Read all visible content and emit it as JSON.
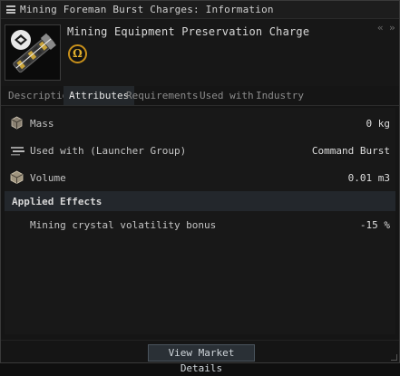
{
  "window": {
    "title": "Mining Foreman Burst Charges: Information"
  },
  "item": {
    "name": "Mining Equipment Preservation Charge",
    "badge_symbol": "Ω",
    "badge_color": "#c8901b",
    "icon": "mining-charge-icon"
  },
  "tabs": [
    {
      "label": "Description",
      "active": false
    },
    {
      "label": "Attributes",
      "active": true
    },
    {
      "label": "Requirements",
      "active": false
    },
    {
      "label": "Used with",
      "active": false
    },
    {
      "label": "Industry",
      "active": false
    }
  ],
  "attributes": [
    {
      "label": "Mass",
      "value": "0 kg",
      "icon": "mass-icon"
    },
    {
      "label": "Used with (Launcher Group)",
      "value": "Command Burst",
      "icon": "launcher-icon"
    },
    {
      "label": "Volume",
      "value": "0.01 m3",
      "icon": "volume-icon"
    }
  ],
  "applied_effects": {
    "header": "Applied Effects",
    "rows": [
      {
        "label": "Mining crystal volatility bonus",
        "value": "-15 %"
      }
    ]
  },
  "footer": {
    "market_button_label": "View Market Details"
  }
}
